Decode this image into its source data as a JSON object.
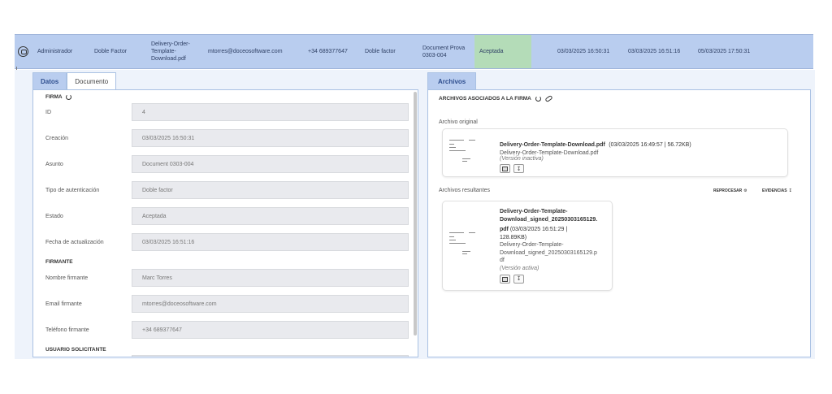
{
  "summary_row": {
    "icon": "document-sign-icon",
    "role": "Administrador",
    "auth_type": "Doble Factor",
    "document_file": "Delivery-Order-Template-Download.pdf",
    "email": "mtorres@doceosoftware.com",
    "phone": "+34 689377647",
    "auth_method": "Doble factor",
    "document_name": "Document Prova 0303-004",
    "status": "Aceptada",
    "created": "03/03/2025 16:50:31",
    "updated": "03/03/2025 16:51:16",
    "expires": "05/03/2025 17:50:31",
    "status_color": "#b4dcb8",
    "row_color": "#b9cdef"
  },
  "left_panel": {
    "tabs": [
      {
        "label": "Datos",
        "active": true
      },
      {
        "label": "Documento",
        "active": false
      }
    ],
    "sections": {
      "firma": "FIRMA",
      "firmante": "FIRMANTE",
      "usuario": "USUARIO SOLICITANTE"
    },
    "fields": [
      {
        "label": "ID",
        "value": "4"
      },
      {
        "label": "Creación",
        "value": "03/03/2025 16:50:31"
      },
      {
        "label": "Asunto",
        "value": "Document 0303-004"
      },
      {
        "label": "Tipo de autenticación",
        "value": "Doble factor"
      },
      {
        "label": "Estado",
        "value": "Aceptada"
      },
      {
        "label": "Fecha de actualización",
        "value": "03/03/2025 16:51:16"
      },
      {
        "label": "Nombre firmante",
        "value": "Marc Torres"
      },
      {
        "label": "Email firmante",
        "value": "mtorres@doceosoftware.com"
      },
      {
        "label": "Teléfono firmante",
        "value": "+34 689377647"
      }
    ]
  },
  "right_panel": {
    "tab": "Archivos",
    "title": "ARCHIVOS ASOCIADOS A LA FIRMA",
    "original_label": "Archivo original",
    "original_file": {
      "name": "Delivery-Order-Template-Download.pdf",
      "meta": "(03/03/2025 16:49:57 | 56.72KB)",
      "filename": "Delivery-Order-Template-Download.pdf",
      "version": "(Versión inactiva)"
    },
    "results_label": "Archivos resultantes",
    "reprocess_label": "REPROCESAR",
    "evidence_label": "EVIDENCIAS",
    "result_file": {
      "name_lines": [
        "Delivery-Order-Template-",
        "Download_signed_20250303165129.",
        "pdf"
      ],
      "meta_lines": [
        " (03/03/2025 16:51:29 |",
        "128.89KB)"
      ],
      "filename_lines": [
        "Delivery-Order-Template-",
        "Download_signed_20250303165129.p",
        "df"
      ],
      "version": "(Versión activa)"
    }
  }
}
